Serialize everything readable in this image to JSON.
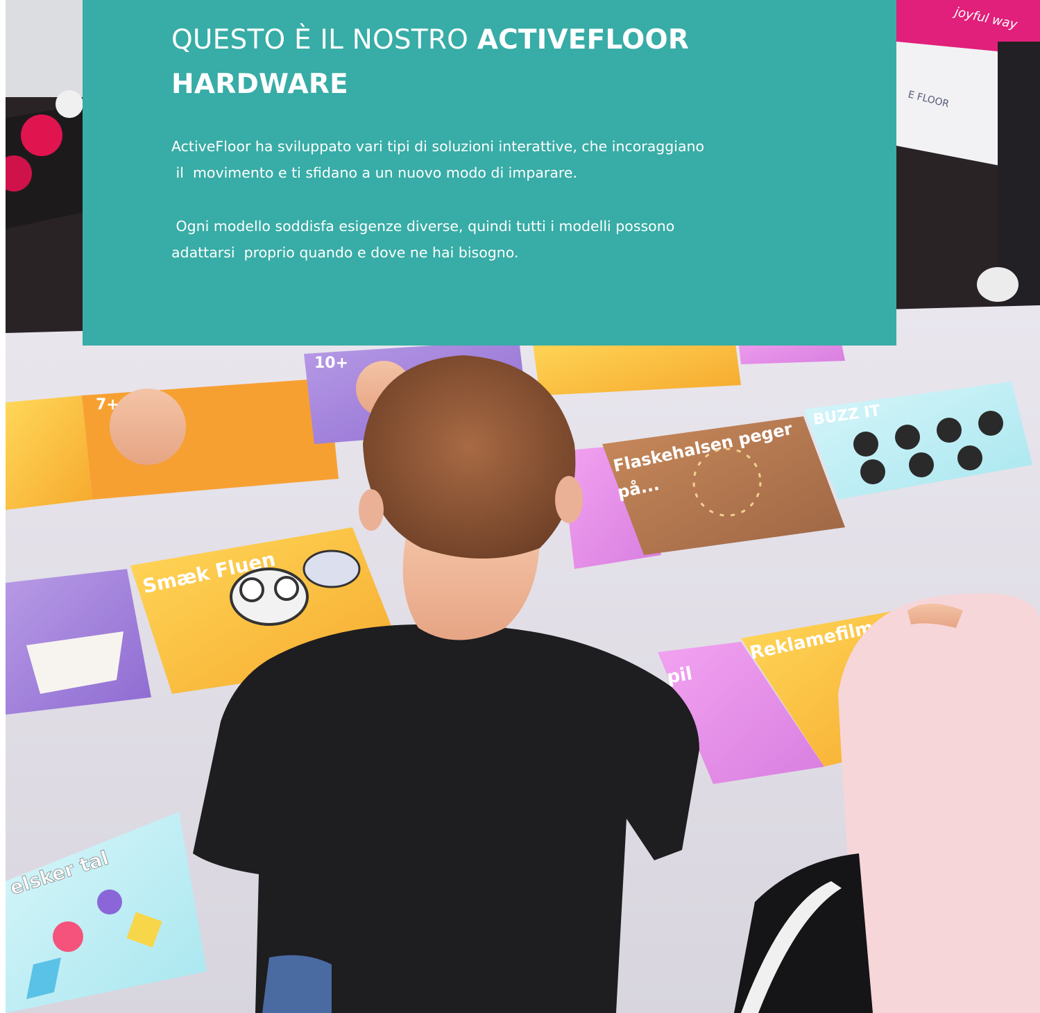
{
  "heading": {
    "line1_light": "QUESTO È IL NOSTRO",
    "line1_bold": "ACTIVEFLOOR",
    "line2_bold": "HARDWARE"
  },
  "paragraph1": {
    "line1": "ActiveFloor ha sviluppato vari tipi di soluzioni interattive, che incoraggiano",
    "line2": " il  movimento e ti sfidano a un nuovo modo di imparare."
  },
  "paragraph2": {
    "line1": " Ogni modello soddisfa esigenze diverse, quindi tutti i modelli possono",
    "line2": "adattarsi  proprio quando e dove ne hai bisogno."
  },
  "photo_tiles": {
    "age_7": "7+",
    "age_10": "10+",
    "game_flaskehalsen": "Flaskehalsen peger",
    "game_flaskehalsen_2": "på...",
    "game_buzz": "BUZZ IT",
    "game_smaek": "Smæk Fluen",
    "game_reklamefilm": "Reklamefilm",
    "game_spil": "pil",
    "game_elsker_tal": "elsker tal",
    "banner_text": "joyful way",
    "banner_logo": "E FLOOR"
  },
  "colors": {
    "teal": "#38aca6",
    "text": "#ffffff"
  }
}
